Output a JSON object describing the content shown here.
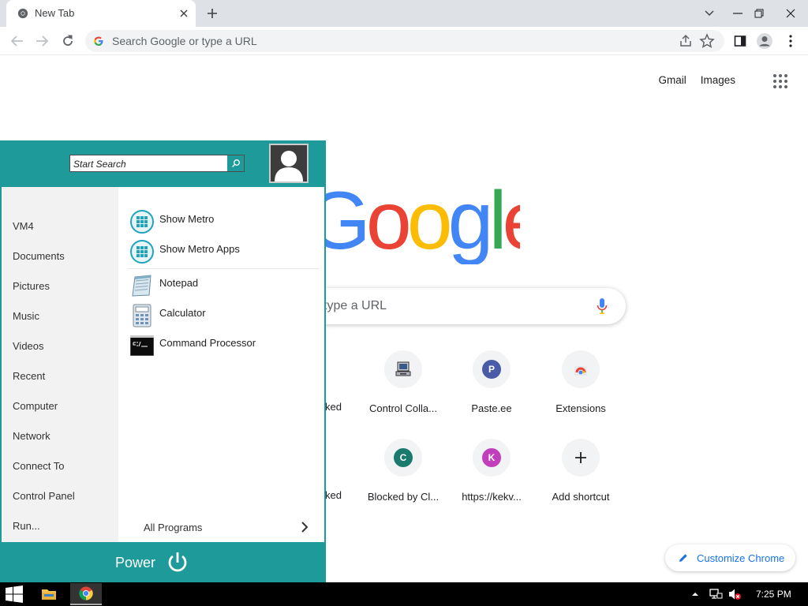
{
  "browser": {
    "tab_title": "New Tab",
    "omnibox_placeholder": "Search Google or type a URL"
  },
  "ntp": {
    "top_links": [
      "Gmail",
      "Images"
    ],
    "logo_text": "Google",
    "search_placeholder": "type a URL",
    "shortcuts": [
      {
        "label": "Control Colla...",
        "icon": "computer-icon"
      },
      {
        "label": "Paste.ee",
        "letter": "P",
        "color": "#4a5ba8"
      },
      {
        "label": "Extensions",
        "icon": "chrome-store-icon"
      },
      {
        "label": "Blocked by Cl...",
        "letter": "C",
        "color": "#1a7a6e"
      },
      {
        "label": "https://kekv...",
        "letter": "K",
        "color": "#c23fbb"
      },
      {
        "label": "Add shortcut",
        "icon": "plus-icon"
      }
    ],
    "partial_labels": [
      "ked",
      "ked"
    ],
    "customize_label": "Customize Chrome"
  },
  "start_menu": {
    "search_placeholder": "Start Search",
    "places": [
      "VM4",
      "Documents",
      "Pictures",
      "Music",
      "Videos",
      "Recent",
      "Computer",
      "Network",
      "Connect To",
      "Control Panel",
      "Run..."
    ],
    "programs": [
      {
        "label": "Show Metro",
        "icon": "metro-icon"
      },
      {
        "label": "Show Metro Apps",
        "icon": "metro-icon"
      },
      {
        "label": "Notepad",
        "icon": "notepad-icon"
      },
      {
        "label": "Calculator",
        "icon": "calculator-icon"
      },
      {
        "label": "Command Processor",
        "icon": "cmd-icon"
      }
    ],
    "all_programs": "All Programs",
    "power_label": "Power",
    "accent_color": "#1f9a9a"
  },
  "taskbar": {
    "time": "7:25 PM"
  }
}
